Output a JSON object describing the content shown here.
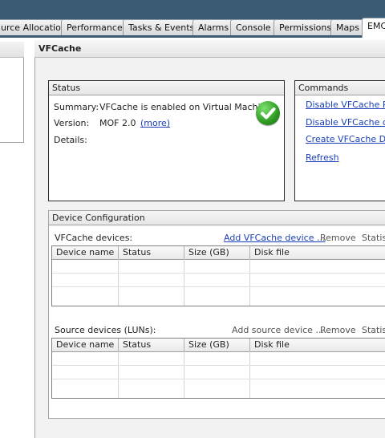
{
  "tabs": [
    {
      "label": "urce Allocation"
    },
    {
      "label": "Performance"
    },
    {
      "label": "Tasks & Events"
    },
    {
      "label": "Alarms"
    },
    {
      "label": "Console"
    },
    {
      "label": "Permissions"
    },
    {
      "label": "Maps"
    },
    {
      "label": "EMC"
    }
  ],
  "main": {
    "title": "VFCache"
  },
  "status": {
    "title": "Status",
    "summary_label": "Summary:",
    "summary_value": "VFCache is enabled on Virtual Machine",
    "version_label": "Version:",
    "version_value": "MOF 2.0",
    "version_link": "(more)",
    "details_label": "Details:",
    "icon": "check-icon"
  },
  "commands": {
    "title": "Commands",
    "items": [
      {
        "label": "Disable VFCache Rem"
      },
      {
        "label": "Disable VFCache on V"
      },
      {
        "label": "Create VFCache Devi"
      },
      {
        "label": "Refresh"
      }
    ]
  },
  "device_config": {
    "title": "Device Configuration",
    "vfcache_label": "VFCache devices:",
    "vfcache_add": "Add VFCache device ...",
    "vfcache_remove": "Remove",
    "vfcache_stats": "Statist",
    "source_label": "Source devices (LUNs):",
    "source_add": "Add source device ...",
    "source_remove": "Remove",
    "source_stats": "Statist",
    "columns": [
      "Device name",
      "Status",
      "Size (GB)",
      "Disk file"
    ]
  }
}
